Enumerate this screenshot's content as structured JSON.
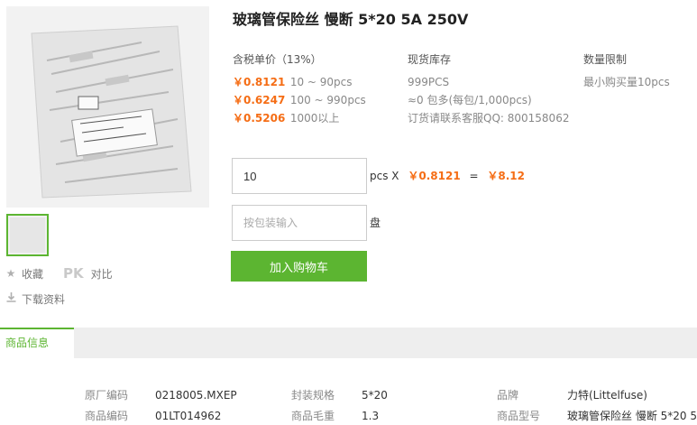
{
  "product": {
    "title": "玻璃管保险丝 慢断 5*20 5A 250V"
  },
  "sidebar": {
    "favorite_label": "收藏",
    "pk_label": "PK",
    "compare_label": "对比",
    "download_label": "下载资料"
  },
  "pricing": {
    "header": "含税单价（13%）",
    "tiers": [
      {
        "price": "￥0.8121",
        "range": "10 ~ 90pcs"
      },
      {
        "price": "￥0.6247",
        "range": "100 ~ 990pcs"
      },
      {
        "price": "￥0.5206",
        "range": "1000以上"
      }
    ]
  },
  "stock": {
    "header": "现货库存",
    "quantity": "999PCS",
    "packages": "≈0 包多(每包/1,000pcs)",
    "contact": "订货请联系客服QQ: 800158062"
  },
  "limit": {
    "header": "数量限制",
    "min": "最小购买量10pcs"
  },
  "order": {
    "quantity": "10",
    "unit": "pcs",
    "times": "X",
    "unit_price": "￥0.8121",
    "equals": "=",
    "total": "￥8.12",
    "package_placeholder": "按包装输入",
    "package_unit": "盘",
    "add_to_cart": "加入购物车"
  },
  "tabs": {
    "product_info": "商品信息"
  },
  "details": {
    "col1": [
      {
        "label": "原厂编码",
        "value": "0218005.MXEP"
      },
      {
        "label": "商品编码",
        "value": "01LT014962"
      }
    ],
    "col2": [
      {
        "label": "封装规格",
        "value": "5*20"
      },
      {
        "label": "商品毛重",
        "value": "1.3"
      }
    ],
    "col3": [
      {
        "label": "品牌",
        "value": "力特(Littelfuse)"
      },
      {
        "label": "商品型号",
        "value": "玻璃管保险丝 慢断 5*20 5..."
      }
    ]
  },
  "colors": {
    "accent_green": "#5cb531",
    "price_orange": "#f56d15"
  }
}
